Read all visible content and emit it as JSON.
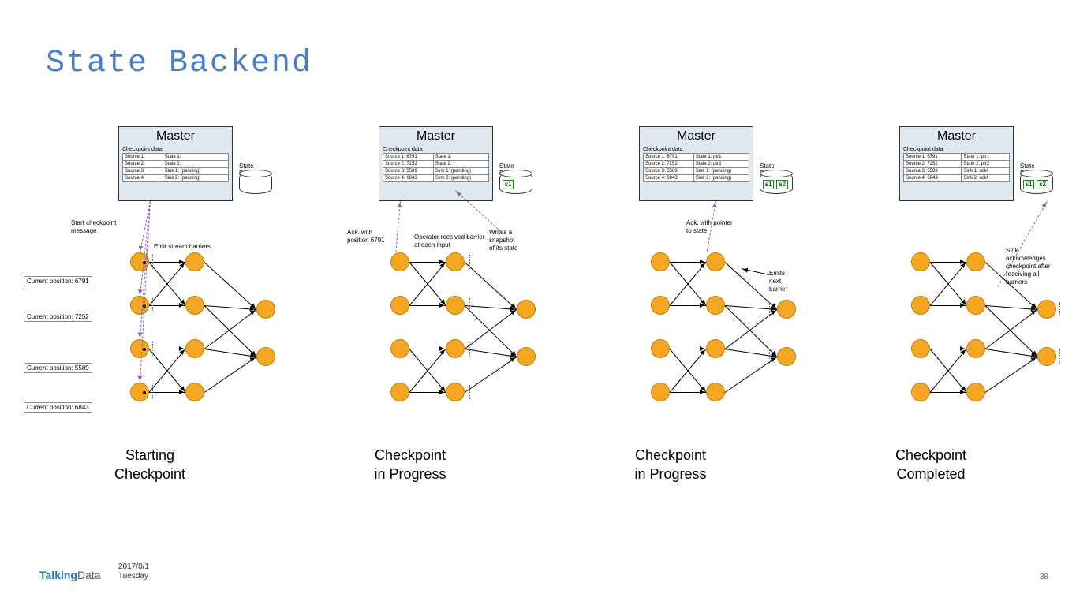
{
  "title": "State Backend",
  "footer": {
    "logo_prefix": "Talking",
    "logo_suffix": "Data",
    "date": "2017/8/1",
    "day": "Tuesday",
    "page": "38"
  },
  "common": {
    "master_title": "Master",
    "checkpoint_data_label": "Checkpoint data",
    "state_backend_label": "State Backend"
  },
  "panels": [
    {
      "id": "starting",
      "caption_l1": "Starting",
      "caption_l2": "Checkpoint",
      "table": [
        [
          "Source 1:",
          "State 1:"
        ],
        [
          "Source 2:",
          "State 2:"
        ],
        [
          "Source 3:",
          "Sink 1: (pending)"
        ],
        [
          "Source 4:",
          "Sink 2: (pending)"
        ]
      ],
      "slots": [],
      "annotations": {
        "start_msg": "Start checkpoint\nmessage",
        "emit_barriers": "Emit stream barriers",
        "pos1": "Current position: 6791",
        "pos2": "Current position: 7252",
        "pos3": "Current position: 5589",
        "pos4": "Current position: 6843"
      },
      "show_dots": true
    },
    {
      "id": "progress1",
      "caption_l1": "Checkpoint",
      "caption_l2": "in Progress",
      "table": [
        [
          "Source 1: 6791",
          "State 1:"
        ],
        [
          "Source 2: 7252",
          "State 2:"
        ],
        [
          "Source 3: 5589",
          "Sink 1: (pending)"
        ],
        [
          "Source 4: 6843",
          "Sink 2: (pending)"
        ]
      ],
      "slots": [
        "s1"
      ],
      "annotations": {
        "ack": "Ack. with\nposition 6791",
        "op_rec": "Operator received barrier\nat each input",
        "writes": "Writes a snapshot\nof its state"
      },
      "show_dots": false
    },
    {
      "id": "progress2",
      "caption_l1": "Checkpoint",
      "caption_l2": "in Progress",
      "table": [
        [
          "Source 1: 6791",
          "State 1: ptr1"
        ],
        [
          "Source 2: 7252",
          "State 2: ptr2"
        ],
        [
          "Source 3: 5589",
          "Sink 1: (pending)"
        ],
        [
          "Source 4: 6843",
          "Sink 2: (pending)"
        ]
      ],
      "slots": [
        "s1",
        "s2"
      ],
      "annotations": {
        "ack_ptr": "Ack. with pointer\nto state",
        "emits_next": "Emits next barrier"
      },
      "show_dots": false
    },
    {
      "id": "completed",
      "caption_l1": "Checkpoint",
      "caption_l2": "Completed",
      "table": [
        [
          "Source 1: 6791",
          "State 1: ptr1"
        ],
        [
          "Source 2: 7252",
          "State 2: ptr2"
        ],
        [
          "Source 3: 5589",
          "Sink 1: ack!"
        ],
        [
          "Source 4: 6843",
          "Sink 2: ack!"
        ]
      ],
      "slots": [
        "s1",
        "s2"
      ],
      "annotations": {
        "sink_ack": "Sink acknowledges\ncheckpoint after\nreceiving all barriers"
      },
      "show_dots": false
    }
  ]
}
